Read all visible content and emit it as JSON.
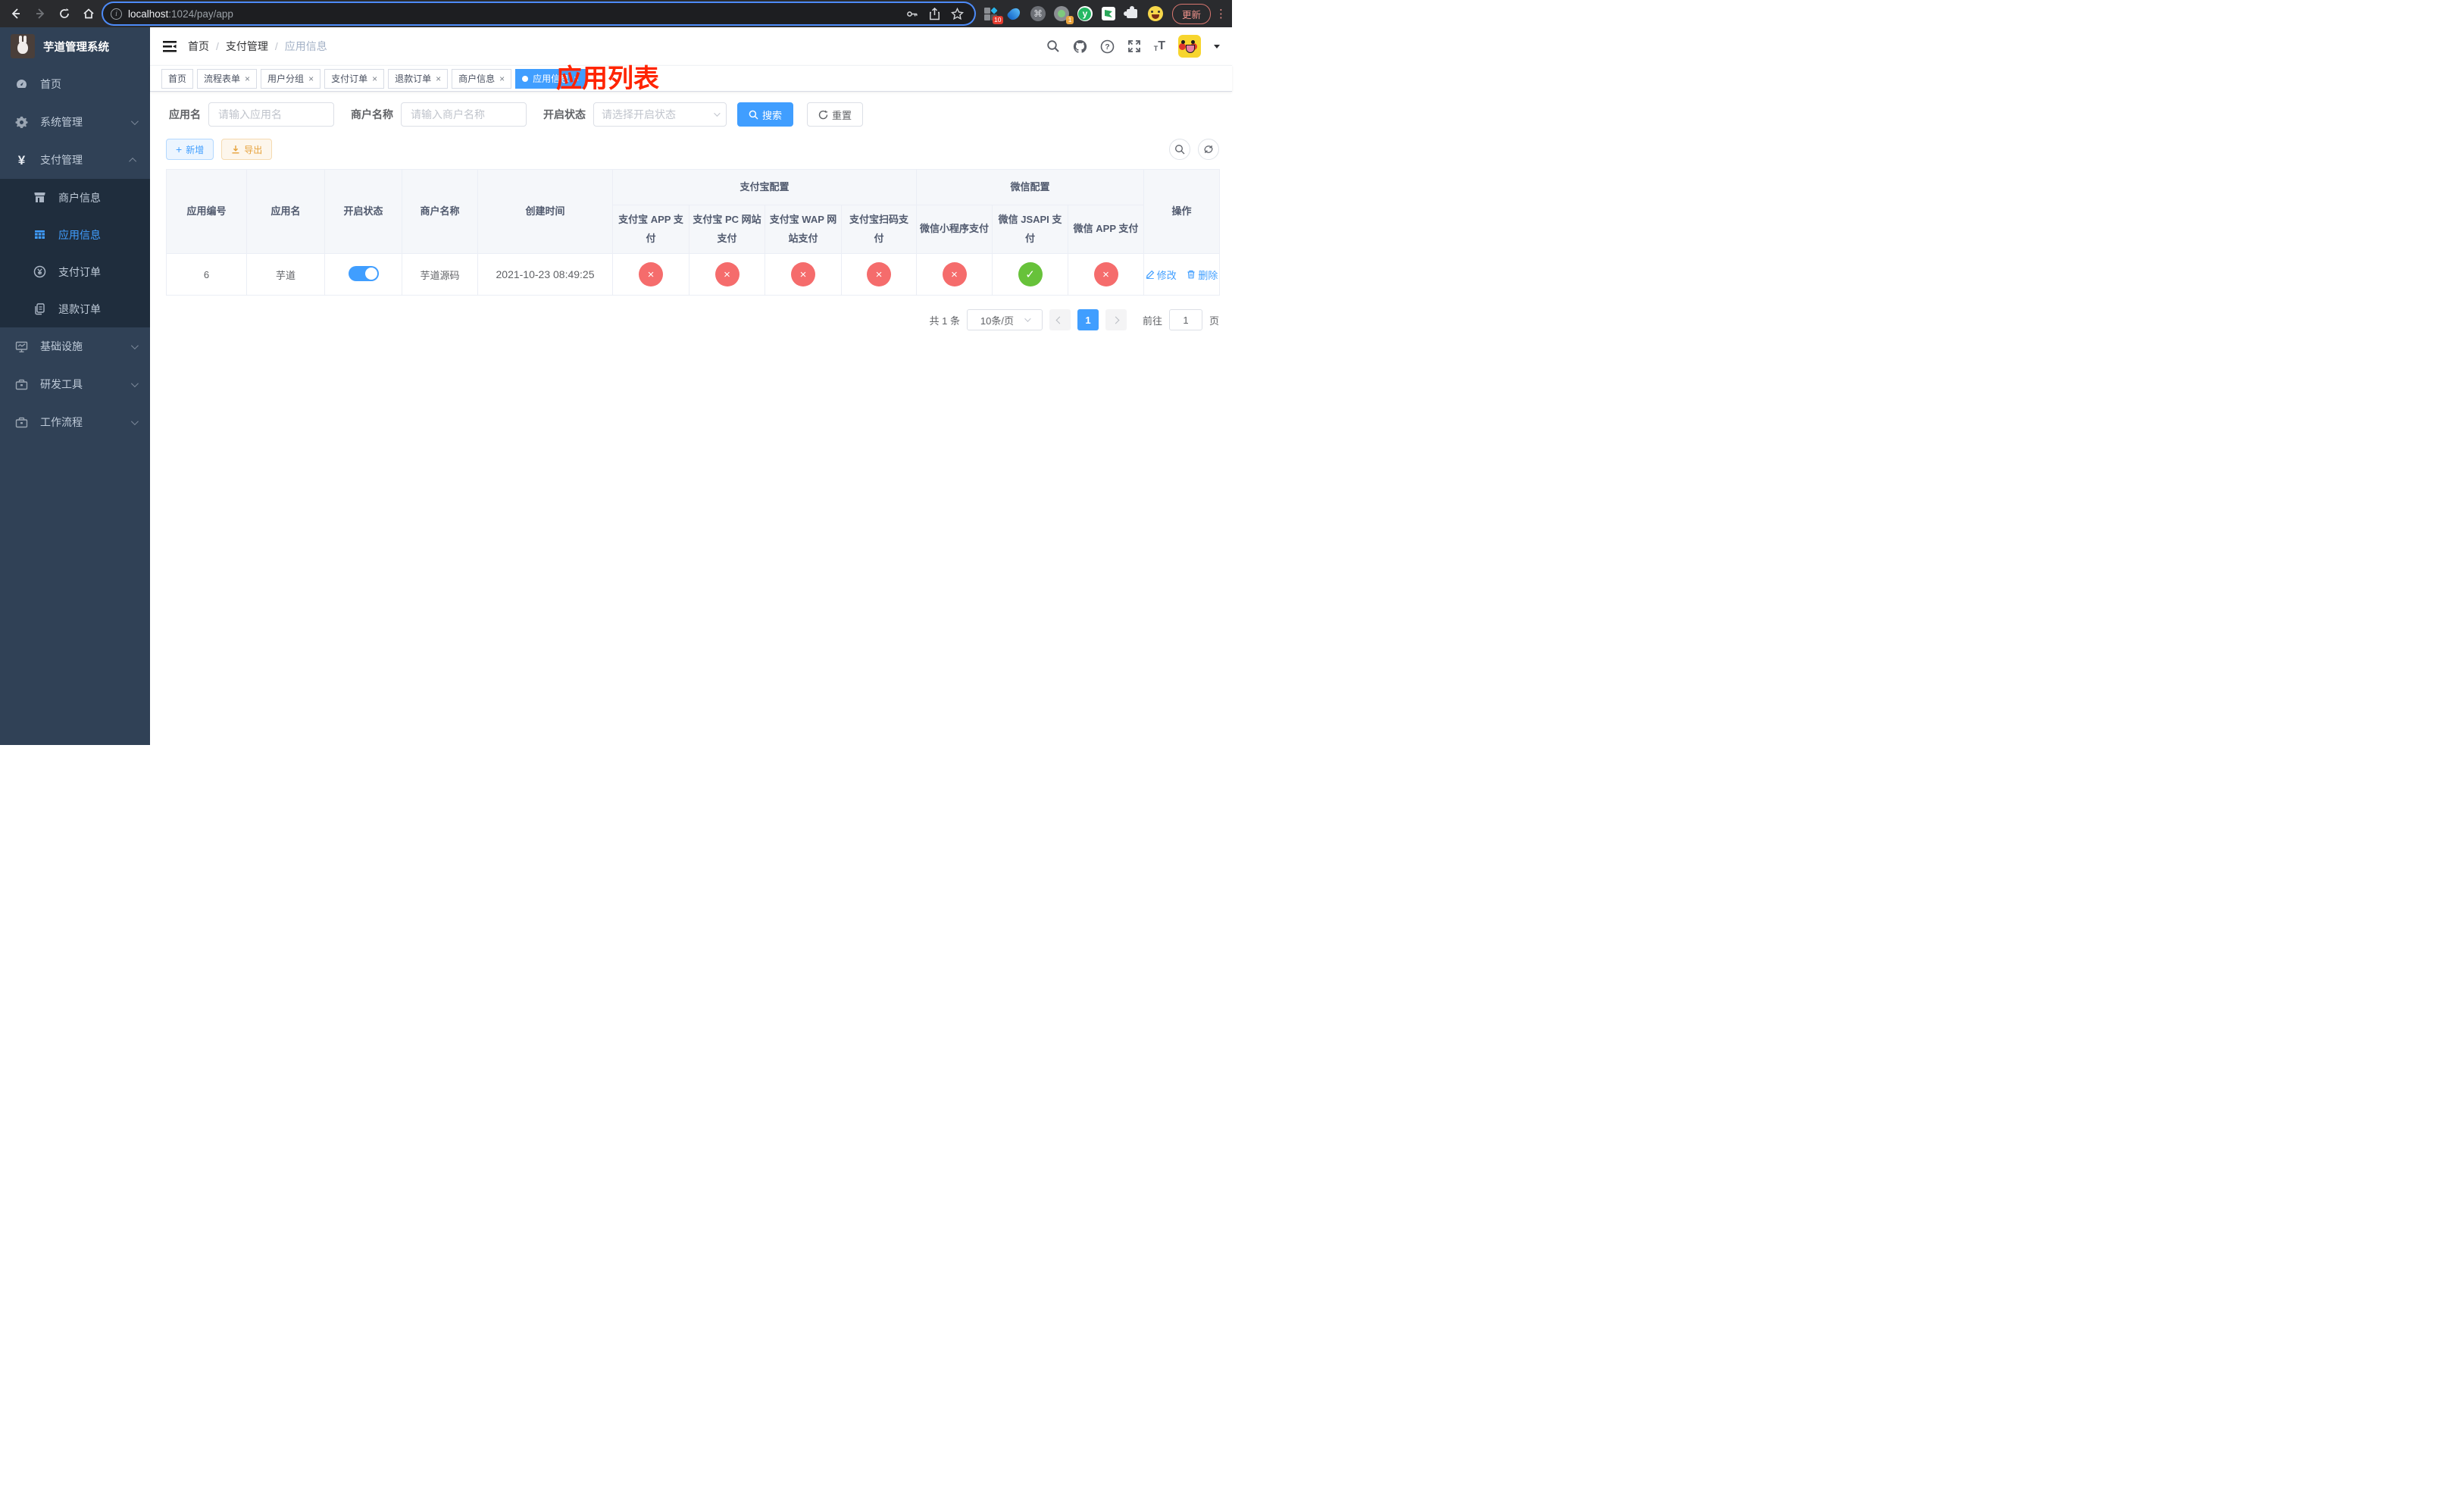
{
  "colors": {
    "accent": "#409eff",
    "success": "#67c23a",
    "danger": "#f56c6c",
    "warning": "#e6a23c",
    "annotation_red": "#ff2400",
    "sidebar_bg": "#304156",
    "submenu_bg": "#1f2d3d"
  },
  "icons": {
    "close": "×",
    "cross": "×",
    "check": "✓",
    "command": "⌘",
    "dots": "⋮",
    "plus": "+",
    "slash": "/"
  },
  "browser": {
    "url_host": "localhost",
    "url_rest": ":1024/pay/app",
    "update_label": "更新",
    "ext_badge_count": "10",
    "recorder_badge": "1",
    "yuque_letter": "y"
  },
  "sidebar": {
    "title": "芋道管理系统",
    "items": [
      {
        "label": "首页"
      },
      {
        "label": "系统管理"
      },
      {
        "label": "支付管理"
      },
      {
        "label": "商户信息"
      },
      {
        "label": "应用信息"
      },
      {
        "label": "支付订单"
      },
      {
        "label": "退款订单"
      },
      {
        "label": "基础设施"
      },
      {
        "label": "研发工具"
      },
      {
        "label": "工作流程"
      }
    ]
  },
  "breadcrumb": {
    "items": [
      "首页",
      "支付管理",
      "应用信息"
    ],
    "separator": "/"
  },
  "annotation": {
    "title": "应用列表"
  },
  "tabs": [
    {
      "label": "首页"
    },
    {
      "label": "流程表单"
    },
    {
      "label": "用户分组"
    },
    {
      "label": "支付订单"
    },
    {
      "label": "退款订单"
    },
    {
      "label": "商户信息"
    },
    {
      "label": "应用信息"
    }
  ],
  "filters": {
    "app_name_label": "应用名",
    "app_name_placeholder": "请输入应用名",
    "merchant_label": "商户名称",
    "merchant_placeholder": "请输入商户名称",
    "status_label": "开启状态",
    "status_placeholder": "请选择开启状态",
    "search_label": "搜索",
    "reset_label": "重置"
  },
  "toolbar": {
    "add_label": "新增",
    "export_label": "导出"
  },
  "table": {
    "headers": {
      "app_id": "应用编号",
      "app_name": "应用名",
      "status": "开启状态",
      "merchant": "商户名称",
      "create_time": "创建时间",
      "alipay_group": "支付宝配置",
      "wechat_group": "微信配置",
      "actions": "操作",
      "sub": [
        "支付宝 APP 支付",
        "支付宝 PC 网站支付",
        "支付宝 WAP 网站支付",
        "支付宝扫码支付",
        "微信小程序支付",
        "微信 JSAPI 支付",
        "微信 APP 支付"
      ]
    },
    "rows": [
      {
        "app_id": "6",
        "app_name": "芋道",
        "status_on": true,
        "merchant": "芋道源码",
        "create_time": "2021-10-23 08:49:25",
        "statuses": [
          {
            "state": "error",
            "glyph": "×"
          },
          {
            "state": "error",
            "glyph": "×"
          },
          {
            "state": "error",
            "glyph": "×"
          },
          {
            "state": "error",
            "glyph": "×"
          },
          {
            "state": "error",
            "glyph": "×"
          },
          {
            "state": "success",
            "glyph": "✓"
          },
          {
            "state": "error",
            "glyph": "×"
          }
        ],
        "edit_label": "修改",
        "delete_label": "删除"
      }
    ]
  },
  "pagination": {
    "total": "共 1 条",
    "page_size": "10条/页",
    "page": "1",
    "goto_label": "前往",
    "goto_value": "1",
    "page_suffix": "页"
  }
}
